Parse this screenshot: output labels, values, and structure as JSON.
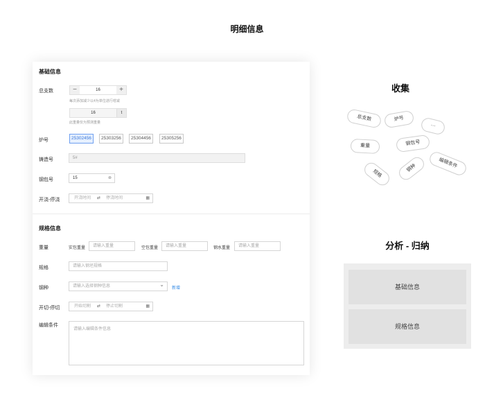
{
  "page_title": "明细信息",
  "basic": {
    "section_title": "基础信息",
    "total_label": "总支数",
    "total_minus": "−",
    "total_value": "16",
    "total_plus": "+",
    "total_hint": "每次添加减少以4为单位进行增减",
    "weight_value": "16",
    "weight_unit": "t",
    "weight_hint": "此重量仅为预测重量",
    "furnace_label": "炉号",
    "furnace_tags": [
      "25302456",
      "25303256",
      "25304456",
      "25305256"
    ],
    "casting_label": "铸造号",
    "casting_value": "5#",
    "steel_pack_label": "钢包号",
    "steel_pack_value": "15",
    "pour_label": "开浇-停浇",
    "pour_start": "开浇时间",
    "pour_end": "停浇时间"
  },
  "spec": {
    "section_title": "规格信息",
    "weight_label": "重量",
    "actual_weight_label": "实包重量",
    "actual_weight_placeholder": "请输入重量",
    "empty_weight_label": "空包重量",
    "empty_weight_placeholder": "请输入重量",
    "steel_water_label": "钢水重量",
    "steel_water_placeholder": "请输入重量",
    "spec_label": "规格",
    "spec_placeholder": "请输入钢坯规格",
    "grade_label": "钢种",
    "grade_placeholder": "请输入选择钢种信息",
    "grade_add": "新增",
    "cut_label": "开切-停切",
    "cut_start": "开始切割",
    "cut_end": "停止切割",
    "edit_label": "编辑条件",
    "edit_placeholder": "请输入编辑条件信息"
  },
  "collect": {
    "title": "收集",
    "pills": [
      "总支数",
      "炉号",
      "···",
      "重量",
      "钢包号",
      "编辑条件",
      "规格",
      "钢种"
    ]
  },
  "analysis": {
    "title": "分析 - 归纳",
    "groups": [
      "基础信息",
      "规格信息"
    ]
  },
  "icons": {
    "swap": "⇄",
    "calendar": "▦",
    "clear": "⊗",
    "chevron": "⌄"
  }
}
